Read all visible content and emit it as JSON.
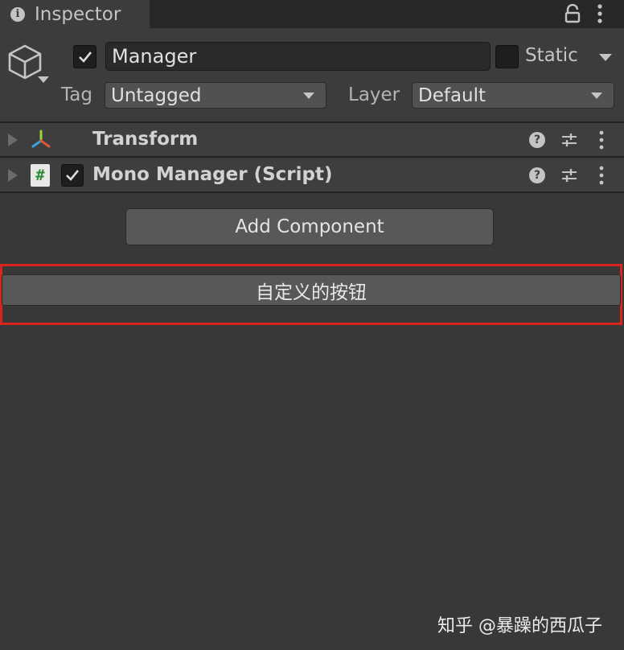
{
  "tab": {
    "title": "Inspector",
    "info_glyph": "i",
    "icon": "info-icon"
  },
  "header": {
    "object_name": "Manager",
    "active": true,
    "static_label": "Static",
    "static_checked": false,
    "tag_label": "Tag",
    "tag_value": "Untagged",
    "layer_label": "Layer",
    "layer_value": "Default"
  },
  "components": [
    {
      "title": "Transform",
      "icon": "transform-axes-icon"
    },
    {
      "title": "Mono Manager (Script)",
      "icon": "csharp-script-icon",
      "script_glyph": "#",
      "enabled": true
    }
  ],
  "help_glyph": "?",
  "add_component_label": "Add Component",
  "custom_button_label": "自定义的按钮",
  "watermark": "知乎 @暴躁的西瓜子",
  "colors": {
    "panel_bg": "#383838",
    "header_bg": "#3c3c3c",
    "button_bg": "#585858",
    "highlight_border": "#d9251d",
    "script_hash": "#2e8b3a"
  }
}
